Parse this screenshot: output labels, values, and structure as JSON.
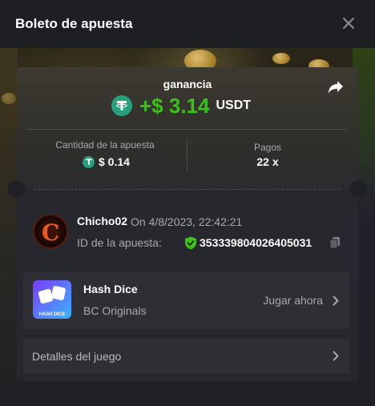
{
  "header": {
    "title": "Boleto de apuesta"
  },
  "profit": {
    "label": "ganancia",
    "amount": "+$ 3.14",
    "currency": "USDT"
  },
  "stats": {
    "bet_amount_label": "Cantidad de la apuesta",
    "bet_amount_value": "$ 0.14",
    "payout_label": "Pagos",
    "payout_value": "22 x"
  },
  "user": {
    "name": "Chicho02",
    "timestamp": "On 4/8/2023, 22:42:21",
    "bet_id_label": "ID de la apuesta:",
    "bet_id_value": "353339804026405031"
  },
  "game": {
    "name": "Hash Dice",
    "provider": "BC Originals",
    "play_label": "Jugar ahora",
    "thumb_label": "HASH DICE"
  },
  "details": {
    "label": "Detalles del juego"
  },
  "colors": {
    "profit_green": "#3bc117",
    "tether_green": "#26a17b",
    "muted_text": "#a6a9ae",
    "card_bg": "#2d2f34"
  },
  "icons": {
    "close": "close-icon",
    "share": "share-icon",
    "currency": "tether-icon",
    "verified": "shield-check-icon",
    "copy": "copy-icon",
    "chevron": "chevron-right-icon"
  }
}
